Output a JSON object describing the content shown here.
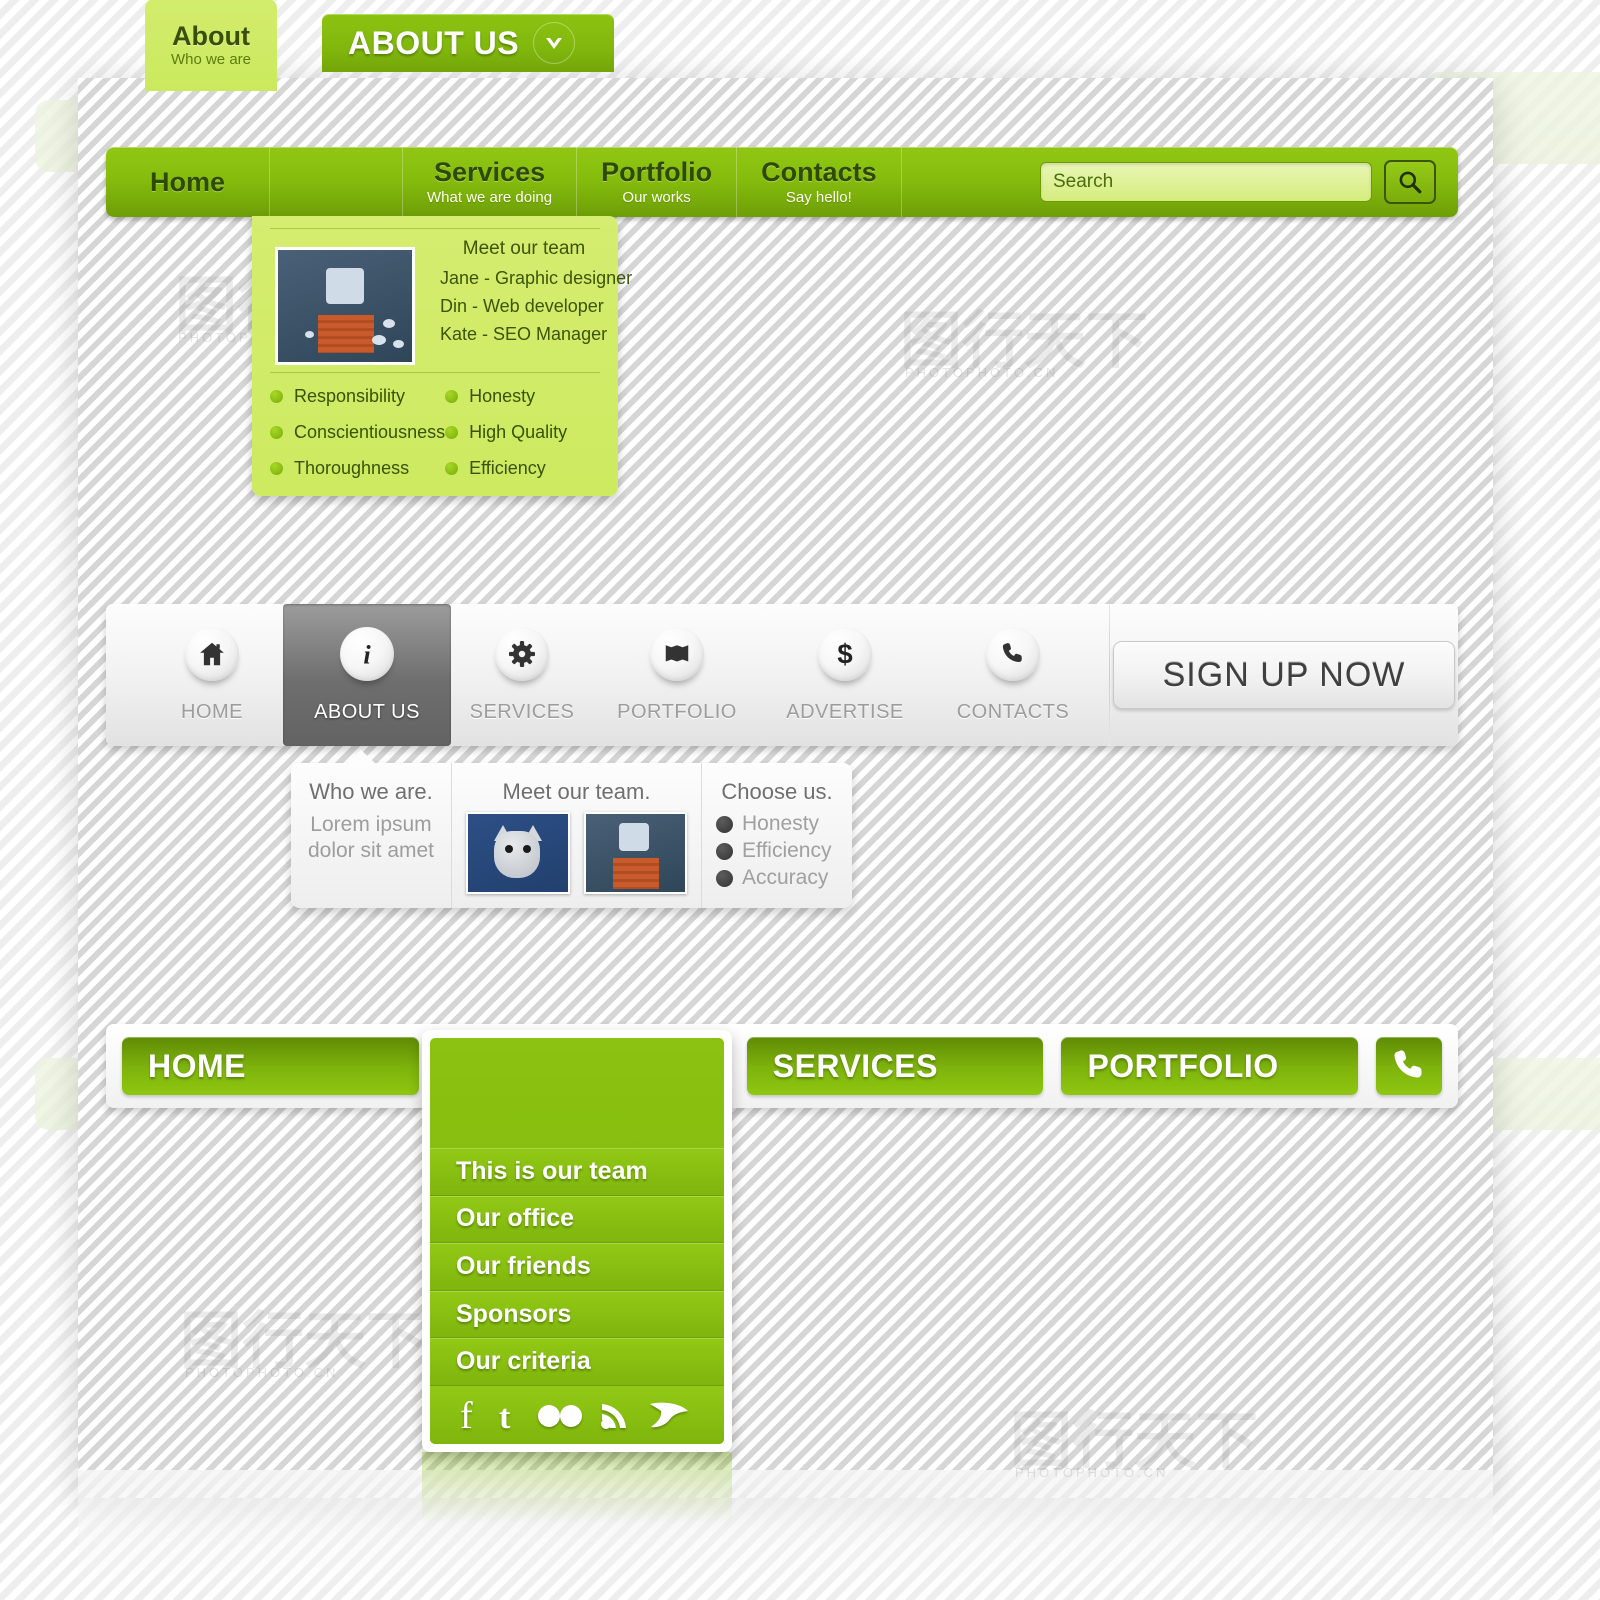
{
  "top_menu": {
    "tabs": [
      {
        "title": "Home",
        "subtitle": ""
      },
      {
        "title": "About",
        "subtitle": "Who we are",
        "active": true
      },
      {
        "title": "Services",
        "subtitle": "What we are doing"
      },
      {
        "title": "Portfolio",
        "subtitle": "Our works"
      },
      {
        "title": "Contacts",
        "subtitle": "Say hello!"
      }
    ],
    "search": {
      "placeholder": "Search",
      "value": "",
      "icon": "search-icon"
    },
    "accent_color": "#86bd0d",
    "active_tab_color": "#cbe95e"
  },
  "about_panel": {
    "team_heading": "Meet our team",
    "team_members": [
      "Jane - Graphic designer",
      "Din - Web developer",
      "Kate - SEO Manager"
    ],
    "features": [
      "Responsibility",
      "Honesty",
      "Conscientiousness",
      "High Quality",
      "Thoroughness",
      "Efficiency"
    ]
  },
  "icon_menu": {
    "items": [
      {
        "label": "HOME",
        "icon": "home-icon",
        "active": false
      },
      {
        "label": "ABOUT US",
        "icon": "info-icon",
        "active": true
      },
      {
        "label": "SERVICES",
        "icon": "gear-icon",
        "active": false
      },
      {
        "label": "PORTFOLIO",
        "icon": "book-icon",
        "active": false
      },
      {
        "label": "ADVERTISE",
        "icon": "dollar-icon",
        "active": false
      },
      {
        "label": "CONTACTS",
        "icon": "phone-icon",
        "active": false
      }
    ],
    "signup_label": "SIGN UP NOW"
  },
  "grey_dropdown": {
    "columns": [
      {
        "heading": "Who we are.",
        "text": "Lorem ipsum dolor sit amet"
      },
      {
        "heading": "Meet our team.",
        "images": [
          "cat-photo",
          "robot-photo"
        ]
      },
      {
        "heading": "Choose us.",
        "items": [
          "Honesty",
          "Efficiency",
          "Accuracy"
        ]
      }
    ]
  },
  "bottom_nav": {
    "buttons": [
      {
        "label": "HOME",
        "style": "dark"
      },
      {
        "label": "ABOUT US",
        "style": "lite",
        "expanded": true,
        "icon": "chevron-down-icon"
      },
      {
        "label": "SERVICES",
        "style": "dark"
      },
      {
        "label": "PORTFOLIO",
        "style": "dark"
      },
      {
        "label": "",
        "style": "dark",
        "icon": "phone-icon"
      }
    ],
    "submenu": [
      "This is our team",
      "Our office",
      "Our friends",
      "Sponsors",
      "Our criteria"
    ],
    "social": [
      "facebook-icon",
      "twitter-icon",
      "flickr-icon",
      "rss-icon",
      "bird-icon"
    ]
  },
  "watermark": {
    "text": "PHOTOPHOTO.CN"
  }
}
